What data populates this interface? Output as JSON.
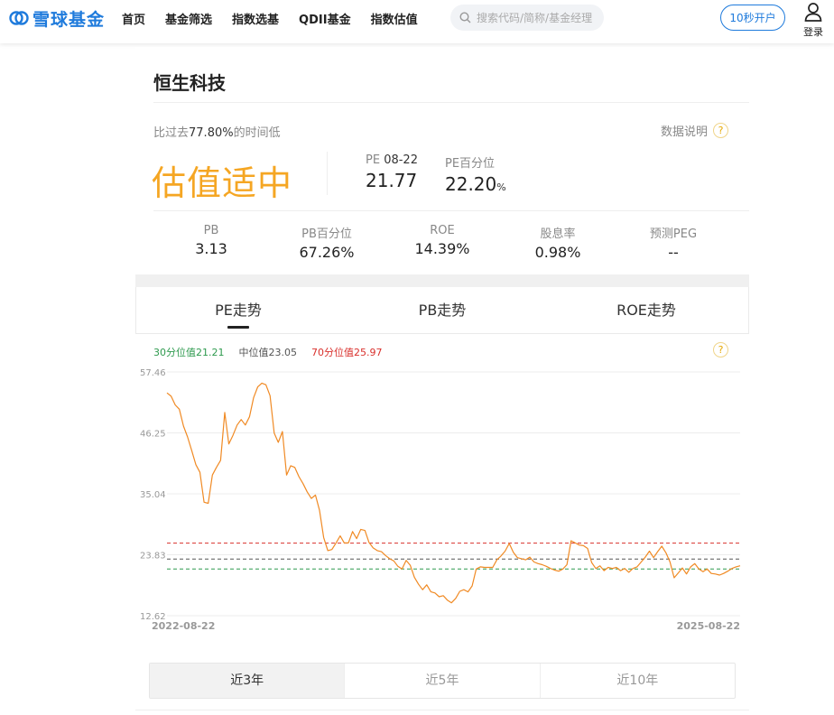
{
  "header": {
    "logo_text": "雪球基金",
    "nav": [
      "首页",
      "基金筛选",
      "指数选基",
      "QDII基金",
      "指数估值"
    ],
    "search_placeholder": "搜索代码/简称/基金经理",
    "open_account": "10秒开户",
    "login": "登录",
    "brand_color": "#1f7bdc"
  },
  "fund": {
    "name": "恒生科技",
    "compare_prefix": "比过去",
    "compare_value": "77.80%",
    "compare_suffix": "的时间低",
    "explain_label": "数据说明",
    "status": "估值适中",
    "status_color": "#f5a623",
    "pe_label": "PE",
    "pe_date": "08-22",
    "pe_value": "21.77",
    "pe_pct_label": "PE百分位",
    "pe_pct_value": "22.20",
    "pe_pct_unit": "%"
  },
  "metrics": [
    {
      "label": "PB",
      "value": "3.13"
    },
    {
      "label": "PB百分位",
      "value": "67.26%"
    },
    {
      "label": "ROE",
      "value": "14.39%"
    },
    {
      "label": "股息率",
      "value": "0.98%"
    },
    {
      "label": "预测PEG",
      "value": "--"
    }
  ],
  "tabs": [
    "PE走势",
    "PB走势",
    "ROE走势"
  ],
  "active_tab": 0,
  "legend": {
    "p30": "30分位值21.21",
    "median": "中位值23.05",
    "p70": "70分位值25.97",
    "p30_color": "#2e9a4e",
    "median_color": "#555555",
    "p70_color": "#d9302c"
  },
  "chart_data": {
    "type": "line",
    "x_start": "2022-08-22",
    "x_end": "2025-08-22",
    "y_ticks": [
      57.46,
      46.25,
      35.04,
      23.83,
      12.62
    ],
    "ylim": [
      12.62,
      57.46
    ],
    "line_color": "#f08a24",
    "reference_lines": [
      {
        "name": "70分位值",
        "value": 25.97,
        "color": "#d9302c"
      },
      {
        "name": "中位值",
        "value": 23.05,
        "color": "#555555"
      },
      {
        "name": "30分位值",
        "value": 21.21,
        "color": "#2e9a4e"
      }
    ],
    "series": [
      {
        "values": [
          53.6,
          53.0,
          51.4,
          50.6,
          47.5,
          45.5,
          43.0,
          40.4,
          39.0,
          33.5,
          33.3,
          38.5,
          39.9,
          41.2,
          50.0,
          44.2,
          45.8,
          47.7,
          48.7,
          47.7,
          49.2,
          52.7,
          54.7,
          55.4,
          55.1,
          53.1,
          46.2,
          44.5,
          46.5,
          38.5,
          40.2,
          39.9,
          38.2,
          36.9,
          35.4,
          34.2,
          34.8,
          32.0,
          27.0,
          24.6,
          24.8,
          26.0,
          27.3,
          26.0,
          26.0,
          28.1,
          26.8,
          28.5,
          28.3,
          26.1,
          25.1,
          24.6,
          24.4,
          23.7,
          23.1,
          22.7,
          21.7,
          21.2,
          22.8,
          21.9,
          19.7,
          18.4,
          17.4,
          18.3,
          17.0,
          16.8,
          16.1,
          16.3,
          15.5,
          15.0,
          15.8,
          17.1,
          17.4,
          17.0,
          18.1,
          21.2,
          21.6,
          21.5,
          21.5,
          21.5,
          22.9,
          23.6,
          24.5,
          25.9,
          24.3,
          23.3,
          23.1,
          22.9,
          23.4,
          22.5,
          22.2,
          22.0,
          21.7,
          21.3,
          21.0,
          20.8,
          21.2,
          22.0,
          26.4,
          26.0,
          25.6,
          25.5,
          25.0,
          22.4,
          21.3,
          21.8,
          20.9,
          21.5,
          21.3,
          21.5,
          20.9,
          21.3,
          20.6,
          21.3,
          21.6,
          22.5,
          23.4,
          24.5,
          23.3,
          24.4,
          25.4,
          24.2,
          22.5,
          19.6,
          20.5,
          21.4,
          20.3,
          21.6,
          22.2,
          21.2,
          20.7,
          21.2,
          20.4,
          20.3,
          20.1,
          20.4,
          20.8,
          21.3,
          21.6,
          21.8
        ]
      }
    ]
  },
  "ranges": [
    "近3年",
    "近5年",
    "近10年"
  ],
  "active_range": 0
}
